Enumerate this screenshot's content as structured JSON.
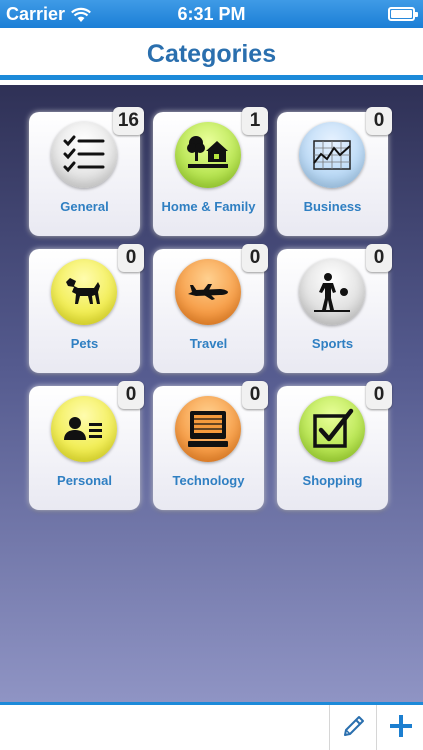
{
  "status_bar": {
    "carrier": "Carrier",
    "time": "6:31 PM"
  },
  "nav": {
    "title": "Categories"
  },
  "colors": {
    "accent": "#1c8ad9",
    "title": "#2a6fae",
    "label": "#2f7fc2"
  },
  "categories": [
    {
      "label": "General",
      "count": "16",
      "icon": "checklist-icon",
      "color": "white"
    },
    {
      "label": "Home & Family",
      "count": "1",
      "icon": "home-family-icon",
      "color": "green"
    },
    {
      "label": "Business",
      "count": "0",
      "icon": "chart-icon",
      "color": "blue"
    },
    {
      "label": "Pets",
      "count": "0",
      "icon": "dog-icon",
      "color": "yellow"
    },
    {
      "label": "Travel",
      "count": "0",
      "icon": "airplane-icon",
      "color": "orange"
    },
    {
      "label": "Sports",
      "count": "0",
      "icon": "athlete-icon",
      "color": "grey"
    },
    {
      "label": "Personal",
      "count": "0",
      "icon": "id-card-icon",
      "color": "yellow"
    },
    {
      "label": "Technology",
      "count": "0",
      "icon": "computer-icon",
      "color": "orange"
    },
    {
      "label": "Shopping",
      "count": "0",
      "icon": "checkbox-icon",
      "color": "green"
    }
  ],
  "toolbar": {
    "edit_icon": "pencil-icon",
    "add_icon": "plus-icon"
  }
}
